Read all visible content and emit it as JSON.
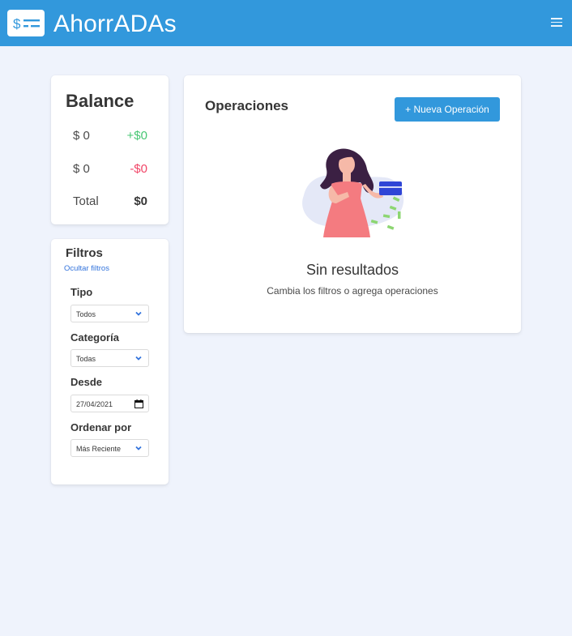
{
  "header": {
    "title": "AhorrADAs",
    "logo_icon": "dollar-bill-icon",
    "menu_icon": "hamburger-menu-icon",
    "background": "#3298dc"
  },
  "balance": {
    "title": "Balance",
    "rows": [
      {
        "label": "$ 0",
        "value": "+$0",
        "color": "#48c774"
      },
      {
        "label": "$ 0",
        "value": "-$0",
        "color": "#f14668"
      },
      {
        "label": "Total",
        "value": "$0",
        "color": "#363636"
      }
    ]
  },
  "filters": {
    "title": "Filtros",
    "toggle_link": "Ocultar filtros",
    "type": {
      "label": "Tipo",
      "value": "Todos"
    },
    "category": {
      "label": "Categoría",
      "value": "Todas"
    },
    "from": {
      "label": "Desde",
      "value": "27/04/2021"
    },
    "sort": {
      "label": "Ordenar por",
      "value": "Más Reciente"
    }
  },
  "operations": {
    "title": "Operaciones",
    "new_button": "+ Nueva Operación",
    "empty_title": "Sin resultados",
    "empty_subtitle": "Cambia los filtros o agrega operaciones",
    "illustration": "woman-holding-credit-card-illustration"
  }
}
